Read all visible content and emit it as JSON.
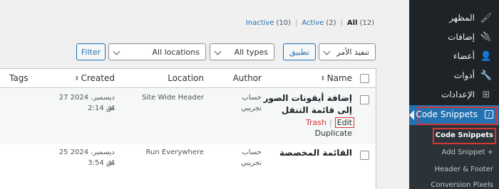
{
  "views": {
    "all": {
      "label": "All",
      "count": "(12)"
    },
    "active": {
      "label": "Active",
      "count": "(2)"
    },
    "inactive": {
      "label": "Inactive",
      "count": "(10)"
    },
    "separator": "|"
  },
  "controls": {
    "bulk_action": "تنفيذ الأمر",
    "apply": "تطبيق",
    "types": "All types",
    "locations": "All locations",
    "filter": "Filter"
  },
  "table": {
    "headers": {
      "name": "Name",
      "author": "Author",
      "location": "Location",
      "created": "Created",
      "tags": "Tags"
    },
    "rows": [
      {
        "title": "إضافة أيقونات الصور إلى قائمة التنقل",
        "author": "حساب تجريبي",
        "location": "Site Wide Header",
        "date": "27 ديسمبر، 2024 at",
        "time": "2:14 ص",
        "actions": {
          "edit": "Edit",
          "trash": "Trash",
          "duplicate": "Duplicate",
          "separator": "|"
        }
      },
      {
        "title": "القائمة المخصصة",
        "author": "حساب تجريبي",
        "location": "Run Everywhere",
        "date": "25 ديسمبر، 2024 at",
        "time": "3:54 ص"
      }
    ]
  },
  "sidebar": {
    "items": [
      {
        "label": "المظهر",
        "icon": "paintbrush-icon"
      },
      {
        "label": "إضافات",
        "icon": "plugin-icon"
      },
      {
        "label": "أعضاء",
        "icon": "user-icon"
      },
      {
        "label": "أدوات",
        "icon": "wrench-icon"
      },
      {
        "label": "الإعدادات",
        "icon": "settings-icon"
      }
    ],
    "active": {
      "label": "Code Snippets",
      "icon": "code-icon"
    },
    "submenu": [
      "Code Snippets",
      "Add Snippet +",
      "Header & Footer",
      "Conversion Pixels"
    ]
  },
  "colors": {
    "accent": "#2271b1",
    "highlight": "#d63638",
    "sidebar": "#1d2327"
  }
}
